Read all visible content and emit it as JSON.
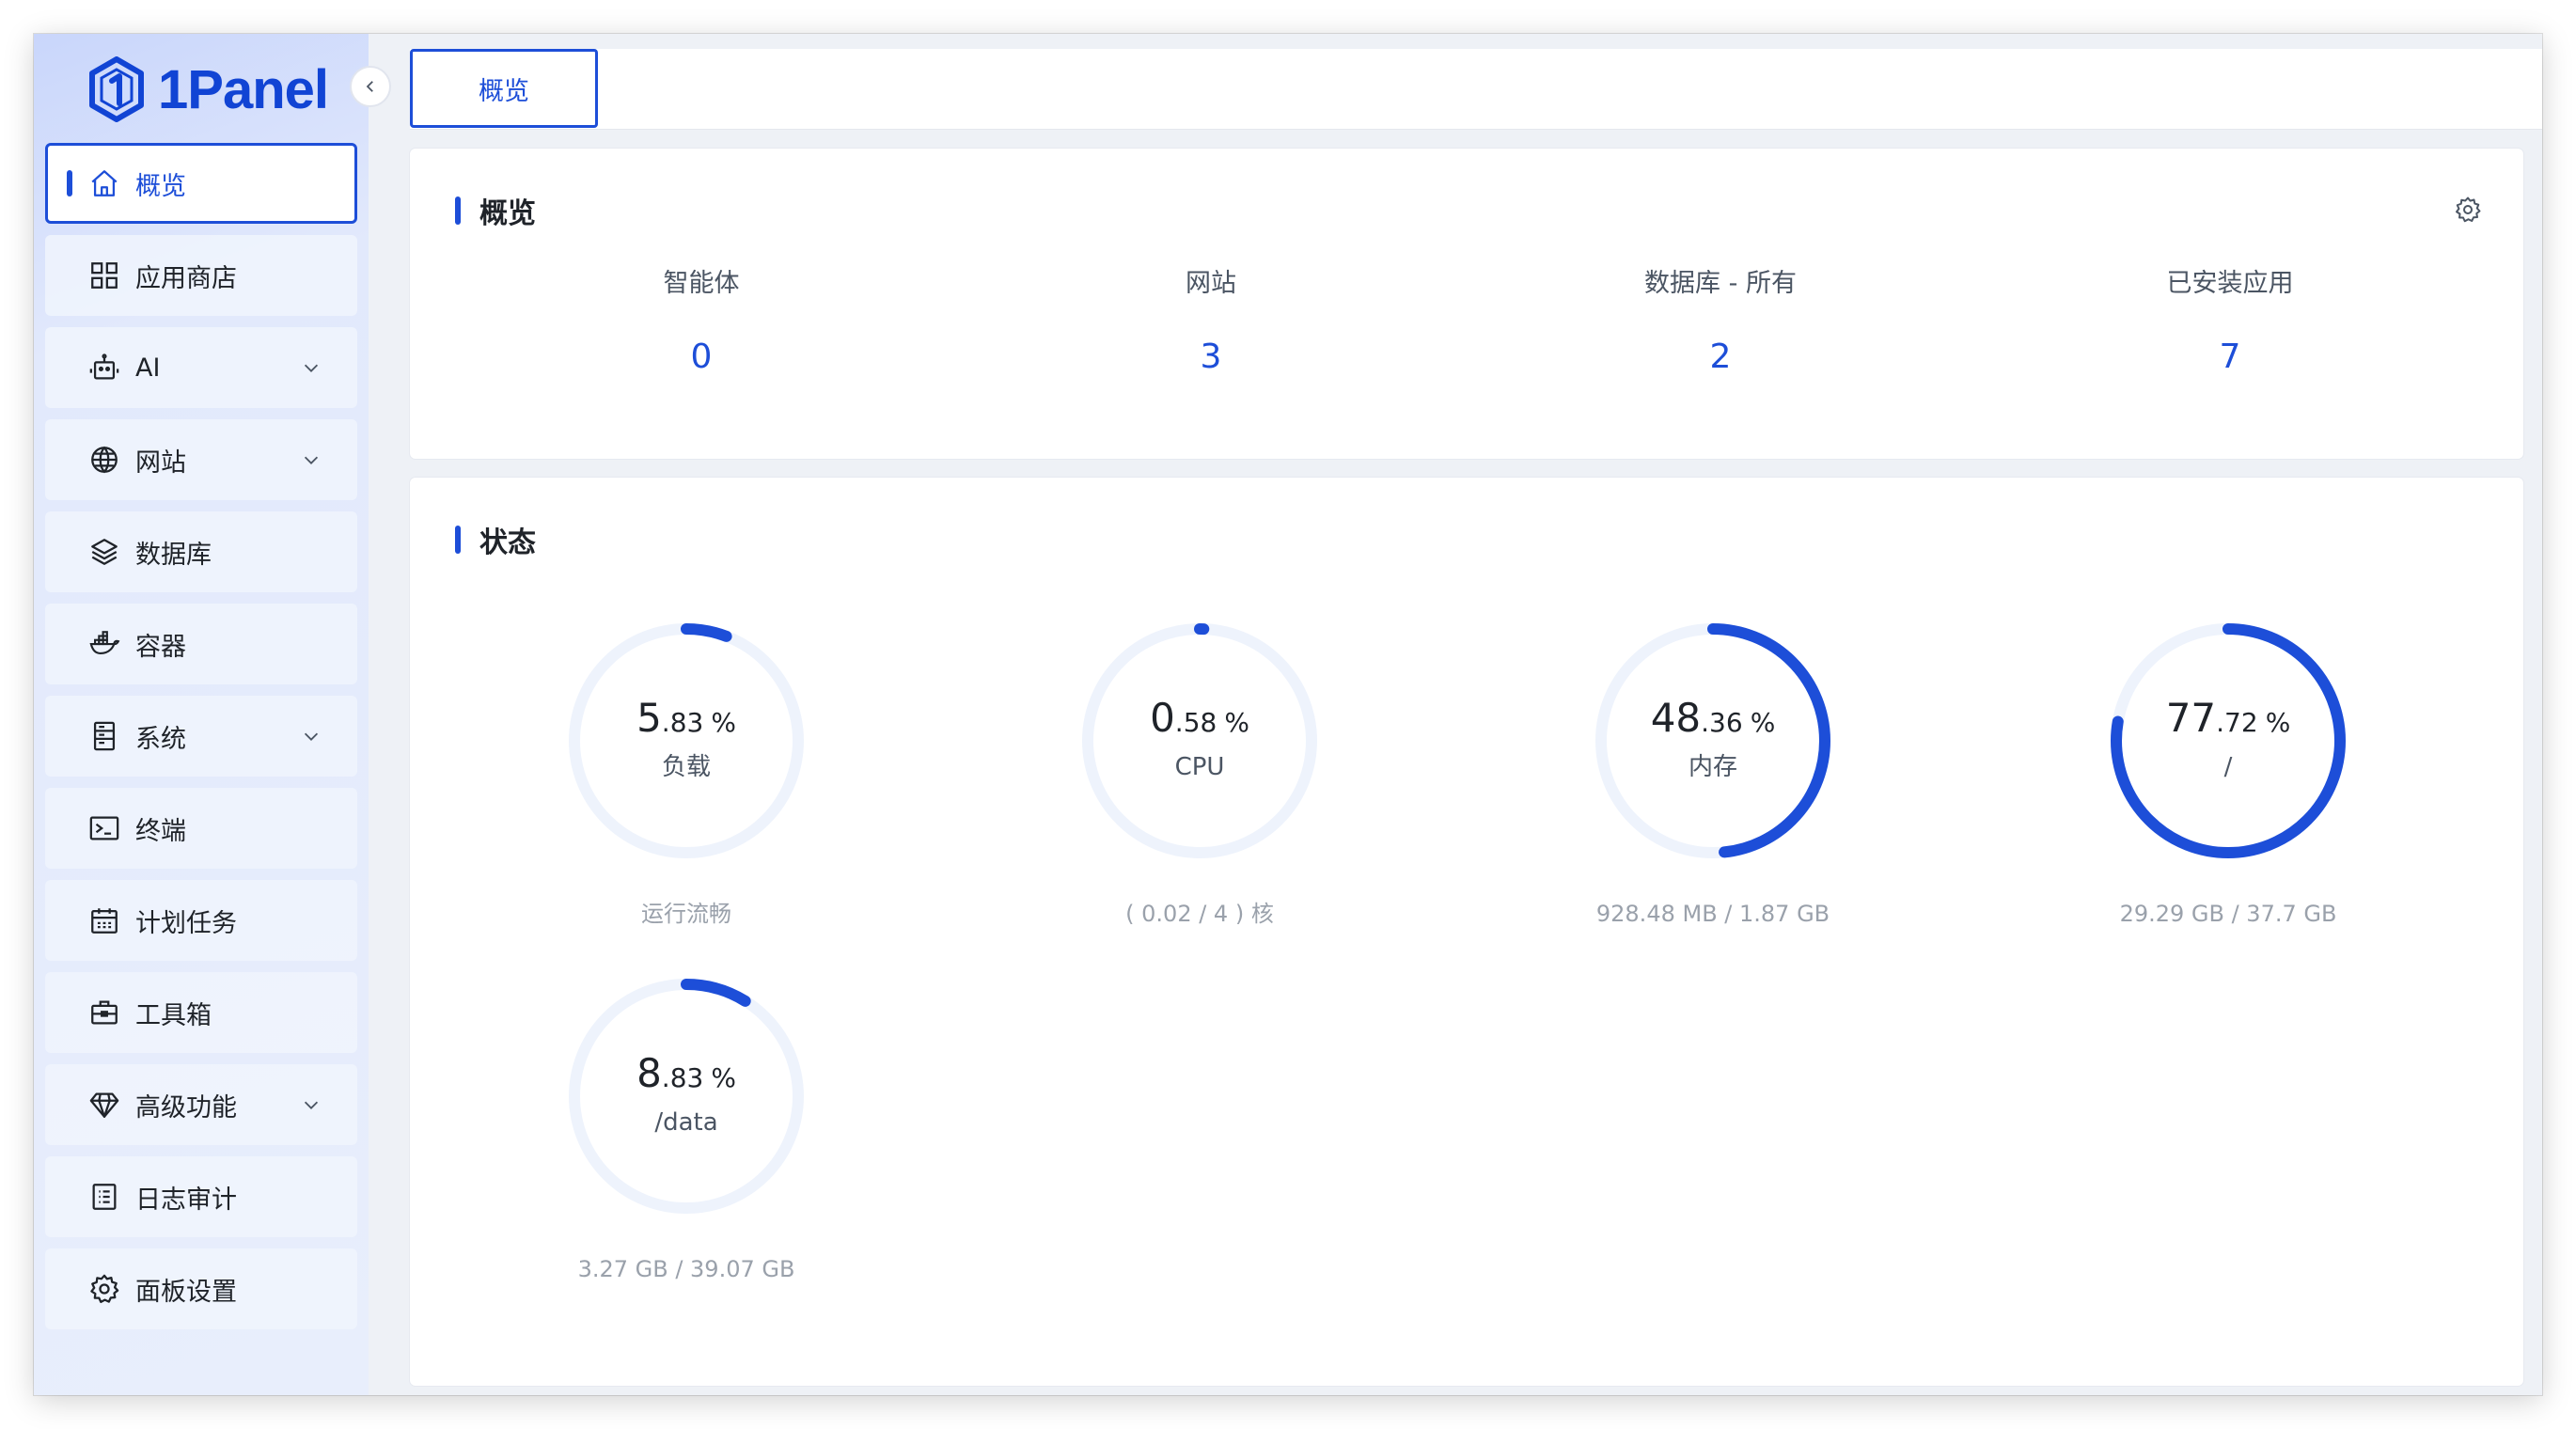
{
  "app": {
    "logo_text": "1Panel"
  },
  "sidebar": {
    "items": [
      {
        "label": "概览",
        "icon": "home-icon",
        "active": true,
        "expandable": false
      },
      {
        "label": "应用商店",
        "icon": "grid-icon",
        "active": false,
        "expandable": false
      },
      {
        "label": "AI",
        "icon": "robot-icon",
        "active": false,
        "expandable": true
      },
      {
        "label": "网站",
        "icon": "globe-icon",
        "active": false,
        "expandable": true
      },
      {
        "label": "数据库",
        "icon": "layers-icon",
        "active": false,
        "expandable": false
      },
      {
        "label": "容器",
        "icon": "docker-icon",
        "active": false,
        "expandable": false
      },
      {
        "label": "系统",
        "icon": "server-icon",
        "active": false,
        "expandable": true
      },
      {
        "label": "终端",
        "icon": "terminal-icon",
        "active": false,
        "expandable": false
      },
      {
        "label": "计划任务",
        "icon": "calendar-icon",
        "active": false,
        "expandable": false
      },
      {
        "label": "工具箱",
        "icon": "toolbox-icon",
        "active": false,
        "expandable": false
      },
      {
        "label": "高级功能",
        "icon": "diamond-icon",
        "active": false,
        "expandable": true
      },
      {
        "label": "日志审计",
        "icon": "log-icon",
        "active": false,
        "expandable": false
      },
      {
        "label": "面板设置",
        "icon": "gear-icon",
        "active": false,
        "expandable": false
      }
    ]
  },
  "tabs": [
    {
      "label": "概览",
      "active": true
    }
  ],
  "overview": {
    "title": "概览",
    "stats": [
      {
        "label": "智能体",
        "value": "0"
      },
      {
        "label": "网站",
        "value": "3"
      },
      {
        "label": "数据库 - 所有",
        "value": "2"
      },
      {
        "label": "已安装应用",
        "value": "7"
      }
    ]
  },
  "status": {
    "title": "状态",
    "gauges": [
      {
        "int": "5",
        "dec": ".83",
        "unit": "%",
        "percent": 5.83,
        "name": "负载",
        "detail": "运行流畅"
      },
      {
        "int": "0",
        "dec": ".58",
        "unit": "%",
        "percent": 0.58,
        "name": "CPU",
        "detail": "( 0.02 / 4 ) 核"
      },
      {
        "int": "48",
        "dec": ".36",
        "unit": "%",
        "percent": 48.36,
        "name": "内存",
        "detail": "928.48 MB / 1.87 GB"
      },
      {
        "int": "77",
        "dec": ".72",
        "unit": "%",
        "percent": 77.72,
        "name": "/",
        "detail": "29.29 GB / 37.7 GB"
      },
      {
        "int": "8",
        "dec": ".83",
        "unit": "%",
        "percent": 8.83,
        "name": "/data",
        "detail": "3.27 GB / 39.07 GB"
      }
    ]
  },
  "colors": {
    "accent": "#1d4ed8",
    "gauge_track": "#eef3fc"
  }
}
